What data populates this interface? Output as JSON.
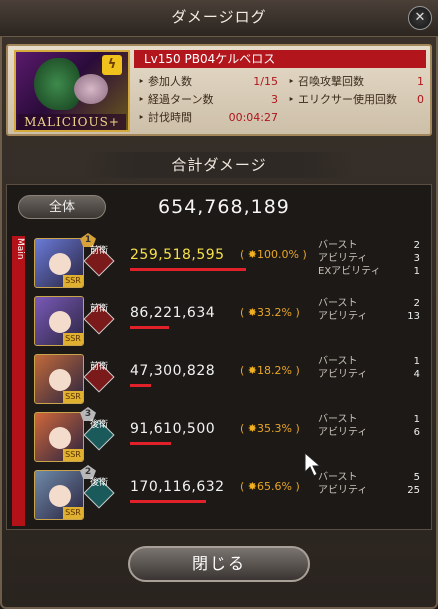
{
  "window": {
    "title": "ダメージログ",
    "close_glyph": "✕"
  },
  "boss": {
    "name": "Lv150 PB04ケルベロス",
    "portrait_tag": "MALICIOUS+",
    "element_glyph": "ϟ",
    "stats_left": [
      {
        "label": "参加人数",
        "value": "1/15"
      },
      {
        "label": "経過ターン数",
        "value": "3"
      },
      {
        "label": "討伐時間",
        "value": "00:04:27"
      }
    ],
    "stats_right": [
      {
        "label": "召喚攻撃回数",
        "value": "1"
      },
      {
        "label": "エリクサー使用回数",
        "value": "0"
      }
    ]
  },
  "total": {
    "section_title": "合計ダメージ",
    "label": "全体",
    "value": "654,768,189"
  },
  "main_label": "Main",
  "entries": [
    {
      "rank": "1",
      "position": "前衛",
      "damage": "259,518,595",
      "percent": "100.0%",
      "percent_value": 100.0,
      "labels": [
        "バースト",
        "アビリティ",
        "EXアビリティ"
      ],
      "counts": [
        "2",
        "3",
        "1"
      ],
      "highlight": true,
      "accent": "#6a7bd8"
    },
    {
      "rank": "",
      "position": "前衛",
      "damage": "86,221,634",
      "percent": "33.2%",
      "percent_value": 33.2,
      "labels": [
        "バースト",
        "アビリティ"
      ],
      "counts": [
        "2",
        "13"
      ],
      "highlight": false,
      "accent": "#7a5ab8"
    },
    {
      "rank": "",
      "position": "前衛",
      "damage": "47,300,828",
      "percent": "18.2%",
      "percent_value": 18.2,
      "labels": [
        "バースト",
        "アビリティ"
      ],
      "counts": [
        "1",
        "4"
      ],
      "highlight": false,
      "accent": "#c26a3a"
    },
    {
      "rank": "3",
      "position": "後衛",
      "damage": "91,610,500",
      "percent": "35.3%",
      "percent_value": 35.3,
      "labels": [
        "バースト",
        "アビリティ"
      ],
      "counts": [
        "1",
        "6"
      ],
      "highlight": false,
      "accent": "#d0673a"
    },
    {
      "rank": "2",
      "position": "後衛",
      "damage": "170,116,632",
      "percent": "65.6%",
      "percent_value": 65.6,
      "labels": [
        "バースト",
        "アビリティ"
      ],
      "counts": [
        "5",
        "25"
      ],
      "highlight": false,
      "accent": "#6e8aa8"
    }
  ],
  "close_button": "閉じる",
  "colors": {
    "front": "#7a1a1a",
    "back": "#1a5a5a",
    "highlight": "#f7e04a",
    "bar": "#e0212a"
  }
}
